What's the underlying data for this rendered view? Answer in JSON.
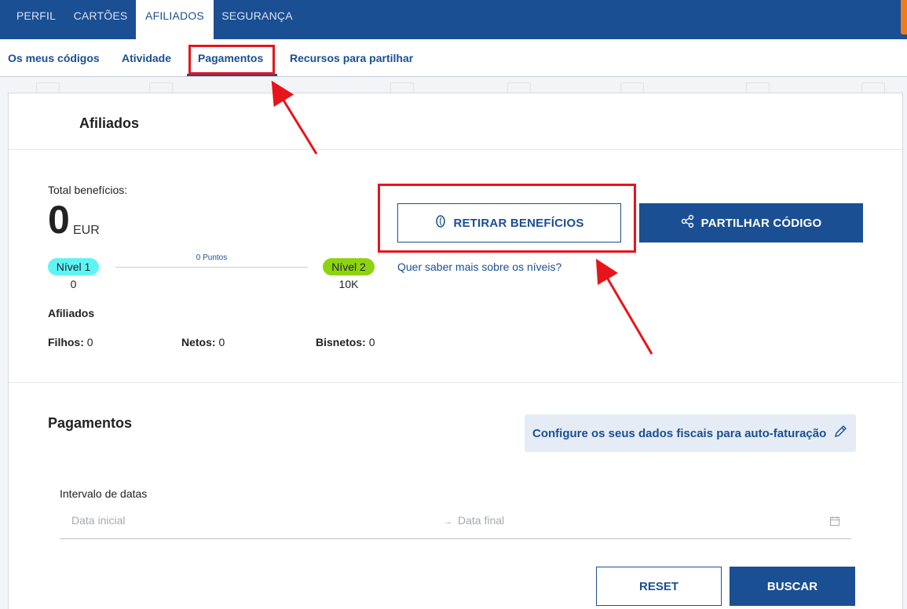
{
  "top_tabs": [
    {
      "label": "PERFIL"
    },
    {
      "label": "CARTÕES"
    },
    {
      "label": "AFILIADOS"
    },
    {
      "label": "SEGURANÇA"
    }
  ],
  "sub_tabs": [
    {
      "label": "Os meus códigos"
    },
    {
      "label": "Atividade"
    },
    {
      "label": "Pagamentos"
    },
    {
      "label": "Recursos para partilhar"
    }
  ],
  "panel": {
    "title": "Afiliados",
    "total_label": "Total benefícios:",
    "total_value": "0",
    "currency": "EUR",
    "level1": {
      "label": "Nível 1",
      "value": "0",
      "color": "#5ff4f4"
    },
    "level2": {
      "label": "Nível 2",
      "value": "10K",
      "color": "#8ed30f"
    },
    "points": "0 Puntos",
    "affiliates_title": "Afiliados",
    "filhos_label": "Filhos:",
    "filhos_value": "0",
    "netos_label": "Netos:",
    "netos_value": "0",
    "bisnetos_label": "Bisnetos:",
    "bisnetos_value": "0",
    "withdraw_button": "RETIRAR BENEFÍCIOS",
    "share_button": "PARTILHAR CÓDIGO",
    "levels_link": "Quer saber mais sobre os níveis?"
  },
  "payments": {
    "title": "Pagamentos",
    "fiscal_button": "Configure os seus dados fiscais para auto-faturação",
    "date_range_label": "Intervalo de datas",
    "start_placeholder": "Data inicial",
    "end_placeholder": "Data final",
    "reset_button": "RESET",
    "search_button": "BUSCAR"
  },
  "colors": {
    "primary": "#1a4f94",
    "highlight": "#e8141b",
    "accent_orange": "#f07d1a"
  }
}
